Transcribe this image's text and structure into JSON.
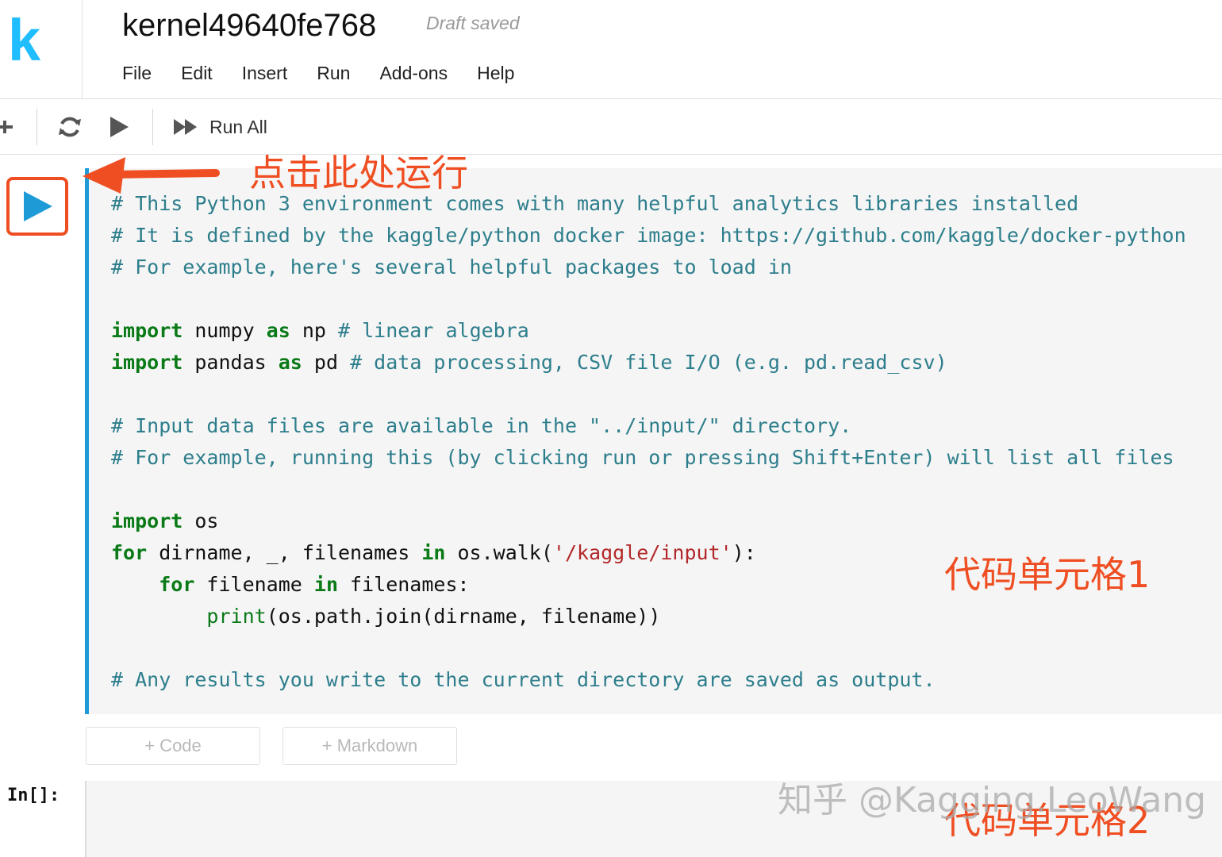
{
  "app": {
    "logo_letter": "k",
    "brand_color": "#20beff"
  },
  "header": {
    "title": "kernel49640fe768",
    "save_status": "Draft saved"
  },
  "menu": [
    "File",
    "Edit",
    "Insert",
    "Run",
    "Add-ons",
    "Help"
  ],
  "toolbar": {
    "icons": [
      "plus-icon",
      "refresh-icon",
      "play-icon",
      "fast-forward-icon"
    ],
    "run_all_label": "Run All"
  },
  "cell1": {
    "accent_color": "#1d9bd7",
    "code_lines": [
      [
        [
          "cm",
          "# This Python 3 environment comes with many helpful analytics libraries installed"
        ]
      ],
      [
        [
          "cm",
          "# It is defined by the kaggle/python docker image: https://github.com/kaggle/docker-python"
        ]
      ],
      [
        [
          "cm",
          "# For example, here's several helpful packages to load in"
        ]
      ],
      [],
      [
        [
          "kw",
          "import"
        ],
        [
          "tx",
          " numpy "
        ],
        [
          "kw",
          "as"
        ],
        [
          "tx",
          " np "
        ],
        [
          "cm",
          "# linear algebra"
        ]
      ],
      [
        [
          "kw",
          "import"
        ],
        [
          "tx",
          " pandas "
        ],
        [
          "kw",
          "as"
        ],
        [
          "tx",
          " pd "
        ],
        [
          "cm",
          "# data processing, CSV file I/O (e.g. pd.read_csv)"
        ]
      ],
      [],
      [
        [
          "cm",
          "# Input data files are available in the \"../input/\" directory."
        ]
      ],
      [
        [
          "cm",
          "# For example, running this (by clicking run or pressing Shift+Enter) will list all files"
        ]
      ],
      [],
      [
        [
          "kw",
          "import"
        ],
        [
          "tx",
          " os"
        ]
      ],
      [
        [
          "kw",
          "for"
        ],
        [
          "tx",
          " dirname, _, filenames "
        ],
        [
          "kw",
          "in"
        ],
        [
          "tx",
          " os.walk("
        ],
        [
          "st",
          "'/kaggle/input'"
        ],
        [
          "tx",
          "):"
        ]
      ],
      [
        [
          "tx",
          "    "
        ],
        [
          "kw",
          "for"
        ],
        [
          "tx",
          " filename "
        ],
        [
          "kw",
          "in"
        ],
        [
          "tx",
          " filenames:"
        ]
      ],
      [
        [
          "tx",
          "        "
        ],
        [
          "bi",
          "print"
        ],
        [
          "tx",
          "(os.path.join(dirname, filename))"
        ]
      ],
      [],
      [
        [
          "cm",
          "# Any results you write to the current directory are saved as output."
        ]
      ]
    ]
  },
  "add_buttons": {
    "code": "+ Code",
    "markdown": "+ Markdown"
  },
  "cell2": {
    "prompt": "In[]:"
  },
  "annotations": {
    "click_here_to_run": "点击此处运行",
    "code_cell_1": "代码单元格1",
    "code_cell_2": "代码单元格2",
    "color": "#ef4e22"
  },
  "watermark": "知乎 @Kagging.LeoWang"
}
